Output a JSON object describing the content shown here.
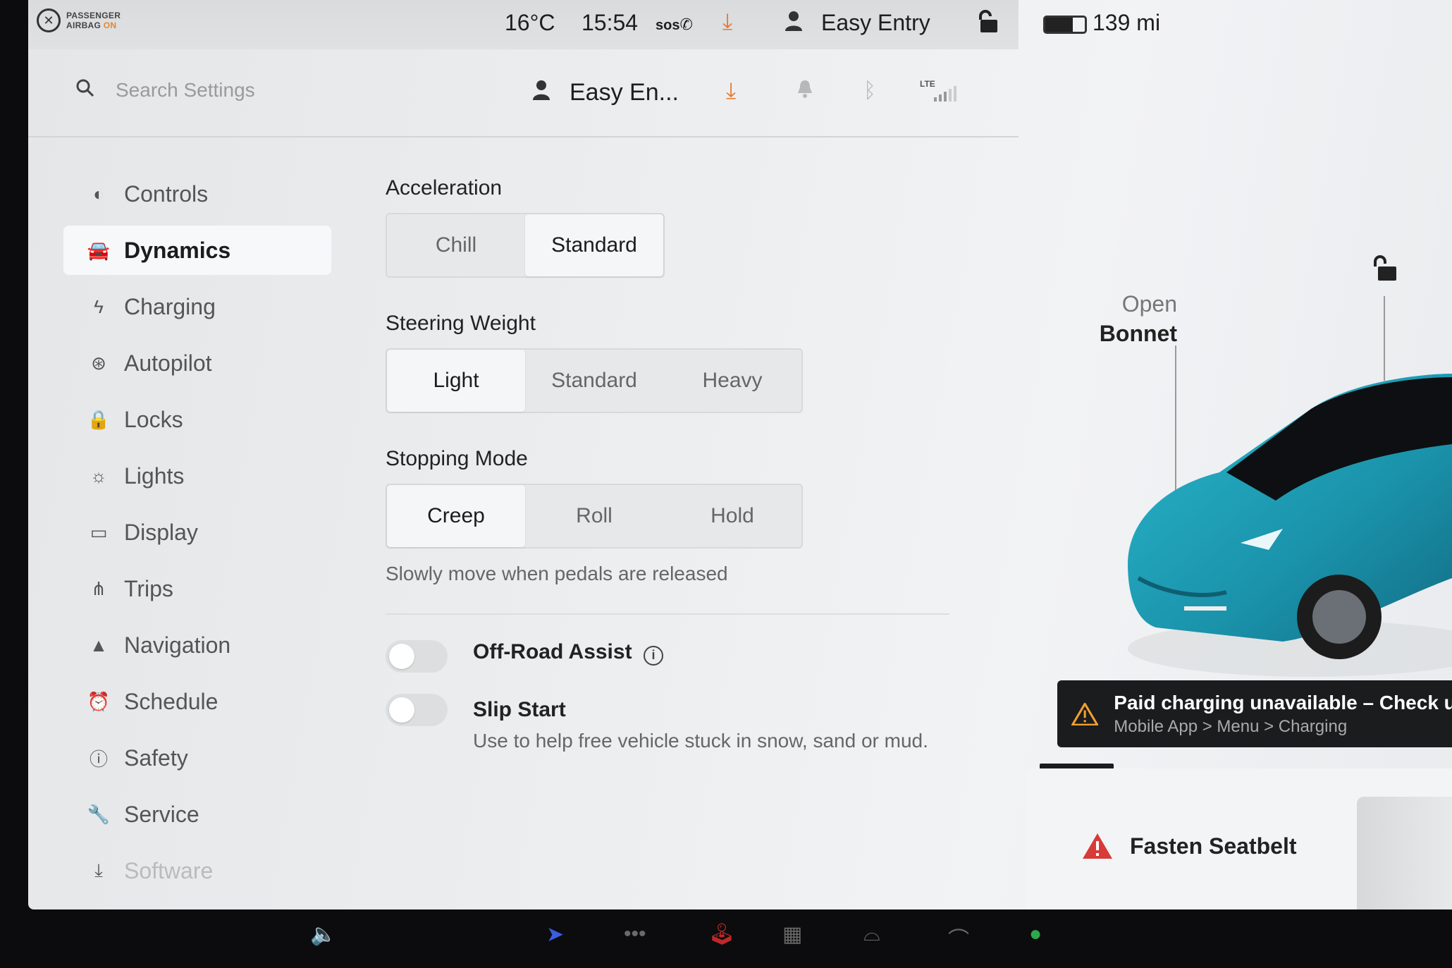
{
  "status_bar": {
    "airbag_label_line1": "PASSENGER",
    "airbag_label_line2": "AIRBAG",
    "airbag_status": "ON",
    "temperature": "16°C",
    "time": "15:54",
    "sos_label": "SOS",
    "profile_name": "Easy Entry",
    "battery_percent": 70,
    "range": "139 mi"
  },
  "header": {
    "search_placeholder": "Search Settings",
    "profile_name": "Easy En...",
    "lte_label": "LTE"
  },
  "sidebar": {
    "items": [
      {
        "label": "Controls",
        "icon": "toggle-icon",
        "active": false
      },
      {
        "label": "Dynamics",
        "icon": "car-icon",
        "active": true
      },
      {
        "label": "Charging",
        "icon": "lightning-icon",
        "active": false
      },
      {
        "label": "Autopilot",
        "icon": "steering-wheel-icon",
        "active": false
      },
      {
        "label": "Locks",
        "icon": "lock-icon",
        "active": false
      },
      {
        "label": "Lights",
        "icon": "sun-icon",
        "active": false
      },
      {
        "label": "Display",
        "icon": "display-icon",
        "active": false
      },
      {
        "label": "Trips",
        "icon": "trips-icon",
        "active": false
      },
      {
        "label": "Navigation",
        "icon": "navigation-icon",
        "active": false
      },
      {
        "label": "Schedule",
        "icon": "alarm-clock-icon",
        "active": false
      },
      {
        "label": "Safety",
        "icon": "safety-icon",
        "active": false
      },
      {
        "label": "Service",
        "icon": "wrench-icon",
        "active": false
      },
      {
        "label": "Software",
        "icon": "download-icon",
        "active": false
      }
    ]
  },
  "main": {
    "acceleration": {
      "title": "Acceleration",
      "options": [
        "Chill",
        "Standard"
      ],
      "selected": "Standard"
    },
    "steering_weight": {
      "title": "Steering Weight",
      "options": [
        "Light",
        "Standard",
        "Heavy"
      ],
      "selected": "Light"
    },
    "stopping_mode": {
      "title": "Stopping Mode",
      "options": [
        "Creep",
        "Roll",
        "Hold"
      ],
      "selected": "Creep",
      "hint": "Slowly move when pedals are released"
    },
    "off_road_assist": {
      "label": "Off-Road Assist",
      "enabled": false
    },
    "slip_start": {
      "label": "Slip Start",
      "enabled": false,
      "description": "Use to help free vehicle stuck in snow, sand or mud."
    }
  },
  "car_panel": {
    "open_bonnet_line1": "Open",
    "open_bonnet_line2": "Bonnet",
    "car_color": "#1fa3b8"
  },
  "alerts": {
    "charging_title": "Paid charging unavailable – Check unp",
    "charging_subtitle": "Mobile App > Menu > Charging",
    "seatbelt_label": "Fasten Seatbelt"
  }
}
